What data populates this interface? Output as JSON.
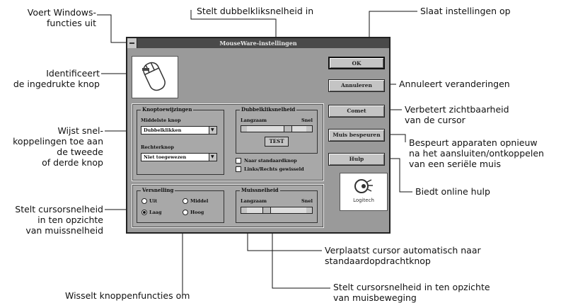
{
  "window": {
    "title": "MouseWare-instellingen",
    "buttons": {
      "ok": "OK",
      "cancel": "Annuleren",
      "comet": "Comet",
      "detect": "Muis bespeuren",
      "help": "Hulp"
    },
    "button_assignments": {
      "label": "Knoptoewijzingen",
      "middle_label": "Middelste knop",
      "middle_value": "Dubbelklikken",
      "right_label": "Rechterknop",
      "right_value": "Niet toegewezen"
    },
    "double_click": {
      "label": "Dubbelkliksnelheid",
      "slow": "Langzaam",
      "fast": "Snel",
      "test": "TEST"
    },
    "checkboxes": {
      "snap": "Naar standaardknop",
      "swap": "Links/Rechts gewisseld"
    },
    "acceleration": {
      "label": "Versnelling",
      "off": "Uit",
      "low": "Laag",
      "medium": "Middel",
      "high": "Hoog"
    },
    "motion": {
      "label": "Muissnelheid",
      "slow": "Langzaam",
      "fast": "Snel"
    },
    "logo": "Logitech"
  },
  "callouts": {
    "sysmenu": [
      "Voert Windows-",
      "functies uit"
    ],
    "dblclick": "Stelt dubbelkliksnelheid in",
    "save": "Slaat instellingen op",
    "identify": [
      "Identificeert",
      "de ingedrukte knop"
    ],
    "cancel": "Annuleert veranderingen",
    "assign": [
      "Wijst snel-",
      "koppelingen toe aan",
      "de tweede",
      "of derde knop"
    ],
    "comet": [
      "Verbetert zichtbaarheid",
      "van de cursor"
    ],
    "detect": [
      "Bespeurt apparaten opnieuw",
      "na  het aansluiten/ontkoppelen",
      "van  een seriële muis"
    ],
    "help": "Biedt online hulp",
    "accel": [
      "Stelt cursorsnelheid",
      "in ten opzichte",
      "van muissnelheid"
    ],
    "snap": [
      "Verplaatst cursor automatisch naar",
      "standaardopdrachtknop"
    ],
    "motion": [
      "Stelt cursorsnelheid in ten opzichte",
      "van muisbeweging"
    ],
    "swap": "Wisselt knoppenfuncties om"
  }
}
